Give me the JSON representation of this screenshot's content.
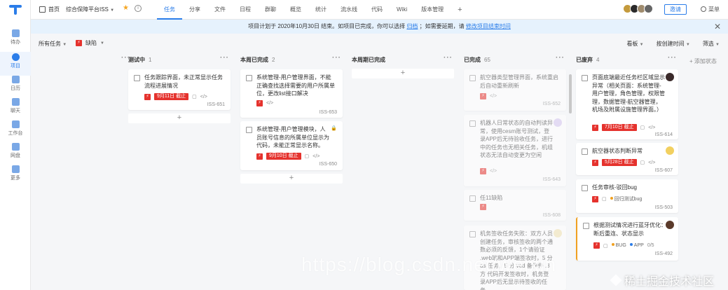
{
  "rail": {
    "items": [
      {
        "label": "待办"
      },
      {
        "label": "项目"
      },
      {
        "label": "日历"
      },
      {
        "label": "聊天"
      },
      {
        "label": "工作台"
      },
      {
        "label": "网盘"
      },
      {
        "label": "更多"
      }
    ]
  },
  "topbar": {
    "home_label": "首页",
    "project_name": "综合保障平台ISS",
    "tabs": [
      "任务",
      "分享",
      "文件",
      "日程",
      "群聊",
      "概览",
      "统计",
      "流水线",
      "代码",
      "Wiki",
      "版本管理"
    ],
    "active_tab": "任务",
    "invite_label": "邀请",
    "menu_label": "菜单"
  },
  "notice": {
    "text_before": "项目计划于 2020年10月30日 结束。如项目已完成，你可以选择",
    "archive_link": "归档",
    "text_after": "；如需要延期，请",
    "extend_link": "修改项目结束时间"
  },
  "filters": {
    "all_tasks": "所有任务",
    "bug_label": "缺陷",
    "bug_icon": "⚡",
    "view": "看板",
    "sort": "按创建时间",
    "filter": "筛选"
  },
  "columns": [
    {
      "name": "测试中",
      "count": "1",
      "cards": [
        {
          "title": "任务跟踪界面，未正常显示任务流程进展情况",
          "due": "9月11日 截止",
          "code": "ISS-651"
        }
      ]
    },
    {
      "name": "本周已完成",
      "count": "2",
      "cards": [
        {
          "title": "系统管理-用户管理界面，不能正确查找选择需要的用户所属单位，更改list接口解决",
          "code": "ISS-653"
        },
        {
          "title": "系统管理-用户管理模块，人员账号信息的所属单位显示为代码，未能正常显示名称。",
          "due": "9月10日 截止",
          "code": "ISS-650"
        }
      ]
    },
    {
      "name": "本周期已完成",
      "count": "",
      "cards": []
    },
    {
      "name": "已完成",
      "count": "65",
      "cards": [
        {
          "title": "航空器类型管理界面，系统重启后自动重新刷新",
          "code": "ISS-652"
        },
        {
          "title": "机器人日常状态的自动判读异常，使用cesm账号测试，登录APP后无待验收任务，进行中的任务也无相关任务，机组状态无法自动变更为空闲",
          "code": "ISS-643"
        },
        {
          "title": "任11缺陷",
          "code": "ISS-608"
        },
        {
          "title": "机务签收任务失败：双方人员创建任务，审核签收的两个通数必须的反馈，1个请验证 .web端和APP端签收时，5 分 ds 任务，5 分 ved 备件件 .3 方 代码开发签收时，机务登录APP后无显示待签收的任务。"
        }
      ]
    },
    {
      "name": "已废弃",
      "count": "4",
      "cards": [
        {
          "title": "页面底端最近任务栏区域显示异常（相关页面：系统管理-用户管理，角色管理，权限管理，数据管理-航空器管理，机场及附属设施管理界面。）",
          "due": "7月10日 截止",
          "code": "ISS-614"
        },
        {
          "title": "航空器状态判断异常",
          "due": "5月28日 截止",
          "code": "ISS-607"
        },
        {
          "title": "任务审核-驳回bug",
          "tag": "回归测试bug",
          "code": "ISS-503"
        },
        {
          "title": "根据测试情况进行蓝牙优化：断后重连、状态显示",
          "tag1": "BUG",
          "tag2": "APP",
          "progress": "0/5",
          "code": "ISS-492"
        }
      ]
    }
  ],
  "add_state": "添加状态",
  "watermark": "https://blog.csdn.net/weixin",
  "juejin_label": "稀土掘金技术社区",
  "colors": {
    "accent": "#2b7de9",
    "due": "#e5322d",
    "star": "#f5a623"
  }
}
